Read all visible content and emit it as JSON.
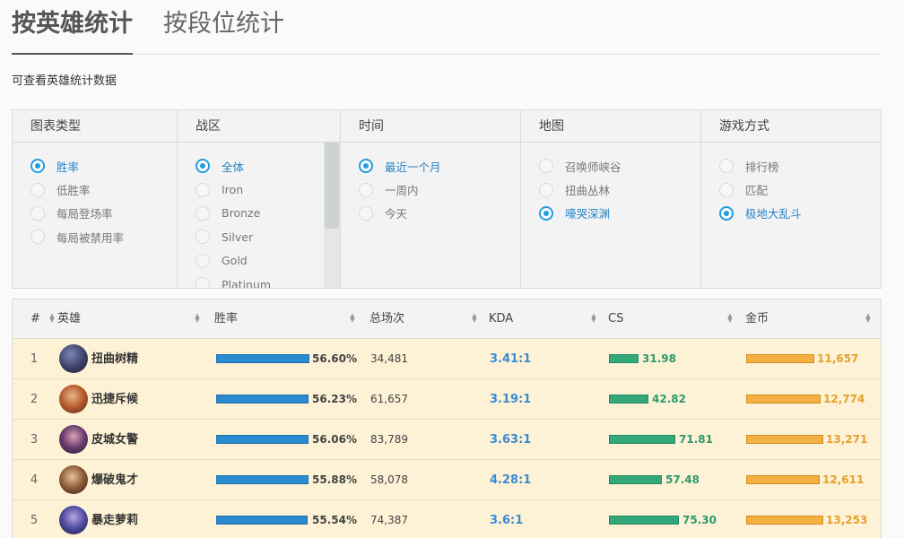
{
  "tabs": [
    {
      "label": "按英雄统计",
      "active": true
    },
    {
      "label": "按段位统计",
      "active": false
    }
  ],
  "subtitle": "可查看英雄统计数据",
  "filters": {
    "chart_type": {
      "title": "图表类型",
      "options": [
        "胜率",
        "低胜率",
        "每局登场率",
        "每局被禁用率"
      ],
      "selected": "胜率"
    },
    "region": {
      "title": "战区",
      "options": [
        "全体",
        "Iron",
        "Bronze",
        "Silver",
        "Gold",
        "Platinum"
      ],
      "selected": "全体"
    },
    "time": {
      "title": "时间",
      "options": [
        "最近一个月",
        "一周内",
        "今天"
      ],
      "selected": "最近一个月"
    },
    "map": {
      "title": "地图",
      "options": [
        "召唤师峡谷",
        "扭曲丛林",
        "嚎哭深渊"
      ],
      "selected": "嚎哭深渊"
    },
    "mode": {
      "title": "游戏方式",
      "options": [
        "排行榜",
        "匹配",
        "极地大乱斗"
      ],
      "selected": "极地大乱斗"
    }
  },
  "table": {
    "headers": {
      "rank": "#",
      "hero": "英雄",
      "winrate": "胜率",
      "games": "总场次",
      "kda": "KDA",
      "cs": "CS",
      "gold": "金币"
    },
    "rows": [
      {
        "rank": "1",
        "hero": "扭曲树精",
        "winrate": "56.60%",
        "win_fraction": 0.566,
        "games": "34,481",
        "kda": "3.41:1",
        "cs": "31.98",
        "cs_fraction": 0.33,
        "gold": "11,657",
        "gold_fraction": 0.63
      },
      {
        "rank": "2",
        "hero": "迅捷斥候",
        "winrate": "56.23%",
        "win_fraction": 0.5623,
        "games": "61,657",
        "kda": "3.19:1",
        "cs": "42.82",
        "cs_fraction": 0.44,
        "gold": "12,774",
        "gold_fraction": 0.69
      },
      {
        "rank": "3",
        "hero": "皮城女警",
        "winrate": "56.06%",
        "win_fraction": 0.5606,
        "games": "83,789",
        "kda": "3.63:1",
        "cs": "71.81",
        "cs_fraction": 0.74,
        "gold": "13,271",
        "gold_fraction": 0.72
      },
      {
        "rank": "4",
        "hero": "爆破鬼才",
        "winrate": "55.88%",
        "win_fraction": 0.5588,
        "games": "58,078",
        "kda": "4.28:1",
        "cs": "57.48",
        "cs_fraction": 0.59,
        "gold": "12,611",
        "gold_fraction": 0.68
      },
      {
        "rank": "5",
        "hero": "暴走萝莉",
        "winrate": "55.54%",
        "win_fraction": 0.5554,
        "games": "74,387",
        "kda": "3.6:1",
        "cs": "75.30",
        "cs_fraction": 0.78,
        "gold": "13,253",
        "gold_fraction": 0.72
      }
    ]
  },
  "colors": {
    "accent": "#1f9de0",
    "winbar": "#2a8bd1",
    "csbar": "#33a87a",
    "goldbar": "#f4b042",
    "row_bg": "#fdf2d6"
  }
}
